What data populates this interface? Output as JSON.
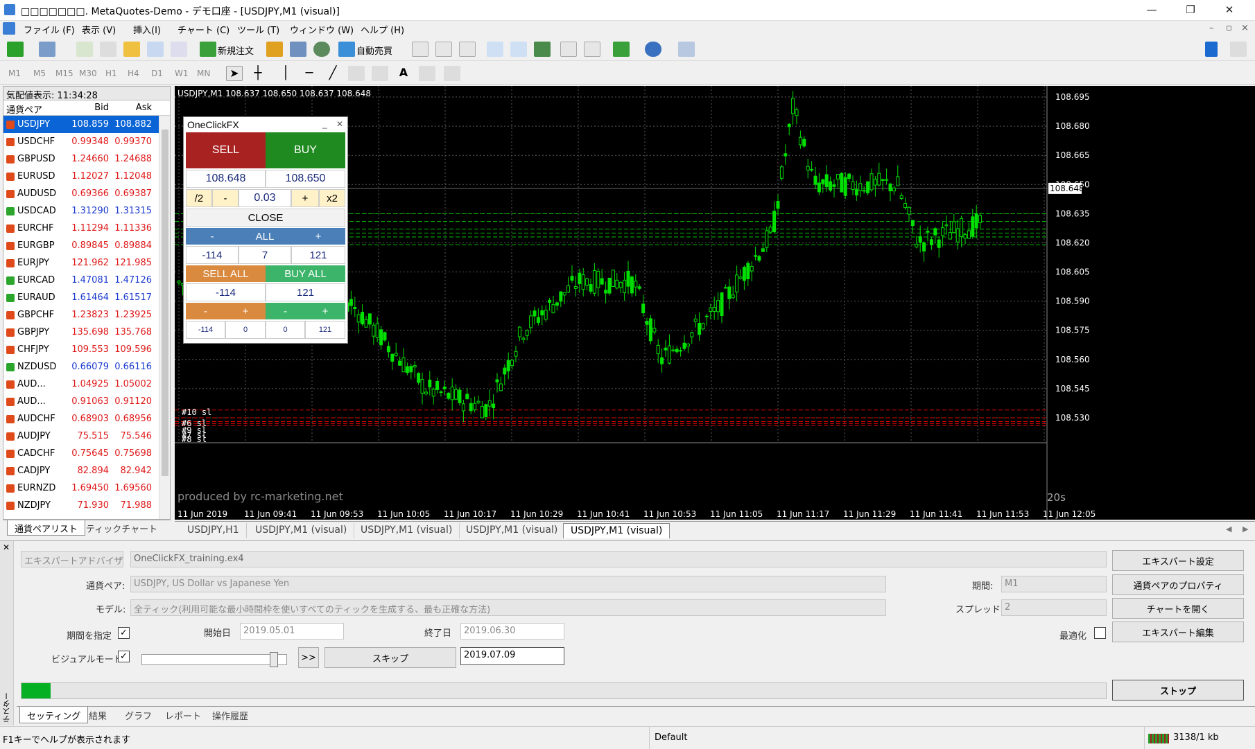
{
  "window": {
    "title": "□□□□□□□. MetaQuotes-Demo - デモ口座 - [USDJPY,M1 (visual)]",
    "minimize": "—",
    "maximize": "❐",
    "close": "✕"
  },
  "menu": [
    "ファイル (F)",
    "表示 (V)",
    "挿入(I)",
    "チャート (C)",
    "ツール (T)",
    "ウィンドウ (W)",
    "ヘルプ (H)"
  ],
  "toolbar": {
    "new_order": "新規注文",
    "auto_trading": "自動売買"
  },
  "timeframes": [
    "M1",
    "M5",
    "M15",
    "M30",
    "H1",
    "H4",
    "D1",
    "W1",
    "MN"
  ],
  "market_watch": {
    "header": "気配値表示: 11:34:28",
    "columns": [
      "通貨ペア",
      "Bid",
      "Ask"
    ],
    "rows": [
      {
        "sym": "USDJPY",
        "bid": "108.859",
        "ask": "108.882",
        "dir": "dn"
      },
      {
        "sym": "USDCHF",
        "bid": "0.99348",
        "ask": "0.99370",
        "dir": "dn"
      },
      {
        "sym": "GBPUSD",
        "bid": "1.24660",
        "ask": "1.24688",
        "dir": "dn"
      },
      {
        "sym": "EURUSD",
        "bid": "1.12027",
        "ask": "1.12048",
        "dir": "dn"
      },
      {
        "sym": "AUDUSD",
        "bid": "0.69366",
        "ask": "0.69387",
        "dir": "dn"
      },
      {
        "sym": "USDCAD",
        "bid": "1.31290",
        "ask": "1.31315",
        "dir": "up"
      },
      {
        "sym": "EURCHF",
        "bid": "1.11294",
        "ask": "1.11336",
        "dir": "dn"
      },
      {
        "sym": "EURGBP",
        "bid": "0.89845",
        "ask": "0.89884",
        "dir": "dn"
      },
      {
        "sym": "EURJPY",
        "bid": "121.962",
        "ask": "121.985",
        "dir": "dn"
      },
      {
        "sym": "EURCAD",
        "bid": "1.47081",
        "ask": "1.47126",
        "dir": "up"
      },
      {
        "sym": "EURAUD",
        "bid": "1.61464",
        "ask": "1.61517",
        "dir": "up"
      },
      {
        "sym": "GBPCHF",
        "bid": "1.23823",
        "ask": "1.23925",
        "dir": "dn"
      },
      {
        "sym": "GBPJPY",
        "bid": "135.698",
        "ask": "135.768",
        "dir": "dn"
      },
      {
        "sym": "CHFJPY",
        "bid": "109.553",
        "ask": "109.596",
        "dir": "dn"
      },
      {
        "sym": "NZDUSD",
        "bid": "0.66079",
        "ask": "0.66116",
        "dir": "up"
      },
      {
        "sym": "AUD...",
        "bid": "1.04925",
        "ask": "1.05002",
        "dir": "dn"
      },
      {
        "sym": "AUD...",
        "bid": "0.91063",
        "ask": "0.91120",
        "dir": "dn"
      },
      {
        "sym": "AUDCHF",
        "bid": "0.68903",
        "ask": "0.68956",
        "dir": "dn"
      },
      {
        "sym": "AUDJPY",
        "bid": "75.515",
        "ask": "75.546",
        "dir": "dn"
      },
      {
        "sym": "CADCHF",
        "bid": "0.75645",
        "ask": "0.75698",
        "dir": "dn"
      },
      {
        "sym": "CADJPY",
        "bid": "82.894",
        "ask": "82.942",
        "dir": "dn"
      },
      {
        "sym": "EURNZD",
        "bid": "1.69450",
        "ask": "1.69560",
        "dir": "dn"
      },
      {
        "sym": "NZDJPY",
        "bid": "71.930",
        "ask": "71.988",
        "dir": "dn"
      }
    ],
    "tabs": [
      "通貨ペアリスト",
      "ティックチャート"
    ]
  },
  "chart": {
    "header": "USDJPY,M1  108.637 108.650 108.637 108.648",
    "price_labels": [
      "108.695",
      "108.680",
      "108.665",
      "108.650",
      "108.635",
      "108.620",
      "108.605",
      "108.590",
      "108.575",
      "108.560",
      "108.545",
      "108.530"
    ],
    "current_price": "108.648",
    "time_labels": [
      "11 Jun 2019",
      "11 Jun 09:41",
      "11 Jun 09:53",
      "11 Jun 10:05",
      "11 Jun 10:17",
      "11 Jun 10:29",
      "11 Jun 10:41",
      "11 Jun 10:53",
      "11 Jun 11:05",
      "11 Jun 11:17",
      "11 Jun 11:29",
      "11 Jun 11:41",
      "11 Jun 11:53",
      "11 Jun 12:05"
    ],
    "sl_labels": [
      "#10 sl",
      "#6 sl",
      "#9 sl",
      "#7 sl",
      "#8 sl"
    ],
    "watermark": "produced by rc-marketing.net",
    "timer": "20s",
    "colors": {
      "bg": "#000000",
      "up": "#00e000",
      "grid": "#5a5a5a",
      "sl": "#e00000",
      "tp": "#00c000"
    }
  },
  "oneclick": {
    "title": "OneClickFX",
    "sell": "SELL",
    "buy": "BUY",
    "sell_price": "108.648",
    "buy_price": "108.650",
    "half": "/2",
    "minus": "-",
    "lot": "0.03",
    "plus": "+",
    "double": "x2",
    "close": "CLOSE",
    "all": "ALL",
    "close_left": "-114",
    "close_mid": "7",
    "close_right": "121",
    "sell_all": "SELL ALL",
    "buy_all": "BUY ALL",
    "sell_all_val": "-114",
    "buy_all_val": "121",
    "small_vals": [
      "-114",
      "0",
      "0",
      "121"
    ]
  },
  "chart_tabs": [
    "USDJPY,H1",
    "USDJPY,M1 (visual)",
    "USDJPY,M1 (visual)",
    "USDJPY,M1 (visual)",
    "USDJPY,M1 (visual)"
  ],
  "tester": {
    "mode": "エキスパートアドバイザ",
    "expert": "OneClickFX_training.ex4",
    "symbol_label": "通貨ペア:",
    "symbol": "USDJPY, US Dollar vs Japanese Yen",
    "model_label": "モデル:",
    "model": "全ティック(利用可能な最小時間枠を使いすべてのティックを生成する、最も正確な方法)",
    "period_chk_label": "期間を指定",
    "start_label": "開始日",
    "start": "2019.05.01",
    "end_label": "終了日",
    "end": "2019.06.30",
    "visual_label": "ビジュアルモード",
    "skip": "スキップ",
    "skip_to": "2019.07.09",
    "ff": ">>",
    "period_label": "期間:",
    "period": "M1",
    "spread_label": "スプレッド:",
    "spread": "2",
    "optimize_label": "最適化",
    "btn_expert_settings": "エキスパート設定",
    "btn_symbol_props": "通貨ペアのプロパティ",
    "btn_open_chart": "チャートを開く",
    "btn_expert_edit": "エキスパート編集",
    "btn_stop": "ストップ",
    "progress": 0.027,
    "side_label": "テスター",
    "tabs": [
      "セッティング",
      "結果",
      "グラフ",
      "レポート",
      "操作履歴"
    ]
  },
  "status": {
    "help": "F1キーでヘルプが表示されます",
    "profile": "Default",
    "traffic": "3138/1 kb"
  }
}
